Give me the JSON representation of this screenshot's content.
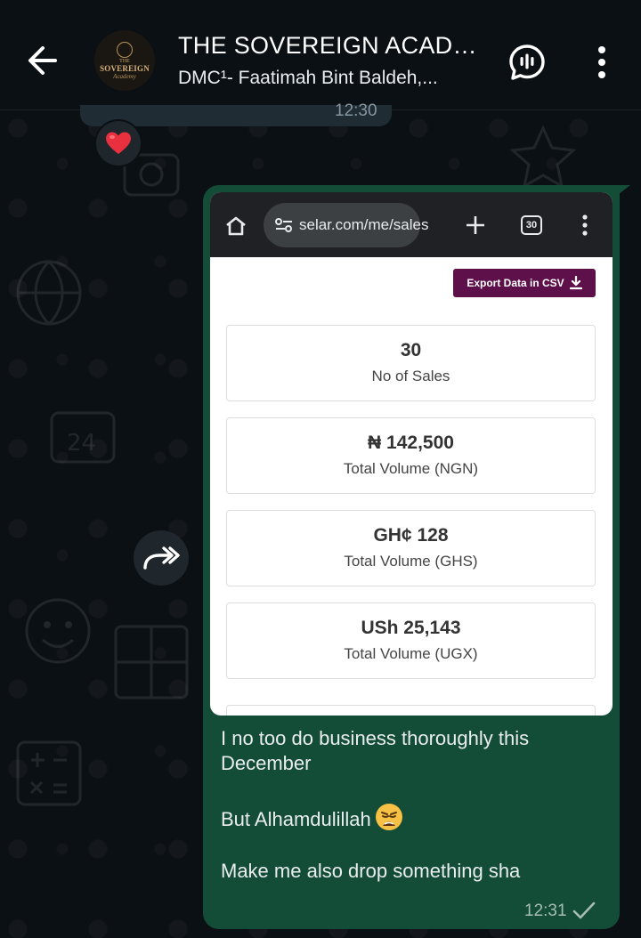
{
  "header": {
    "title": "THE SOVEREIGN ACADE...",
    "subtitle": "DMC¹- Faatimah Bint Baldeh,...",
    "avatar": {
      "line1": "THE",
      "line2": "SOVEREIGN",
      "line3": "Academy"
    }
  },
  "previous_message": {
    "time": "12:30",
    "reaction": "heart-emoji"
  },
  "message": {
    "browser": {
      "url": "selar.com/me/sales",
      "tabs_count": "30"
    },
    "export_button": "Export Data in CSV",
    "stats": [
      {
        "value": "30",
        "label": "No of Sales"
      },
      {
        "value": "₦ 142,500",
        "label": "Total Volume (NGN)"
      },
      {
        "value": "GH¢ 128",
        "label": "Total Volume (GHS)"
      },
      {
        "value": "USh 25,143",
        "label": "Total Volume (UGX)"
      }
    ],
    "text_lines": [
      "I no too do business thoroughly this December",
      "But Alhamdulillah",
      "Make me also drop something sha"
    ],
    "time": "12:31",
    "status": "delivered"
  },
  "colors": {
    "bubble": "#144d37",
    "export_button": "#5d1049",
    "background": "#0b1014"
  }
}
